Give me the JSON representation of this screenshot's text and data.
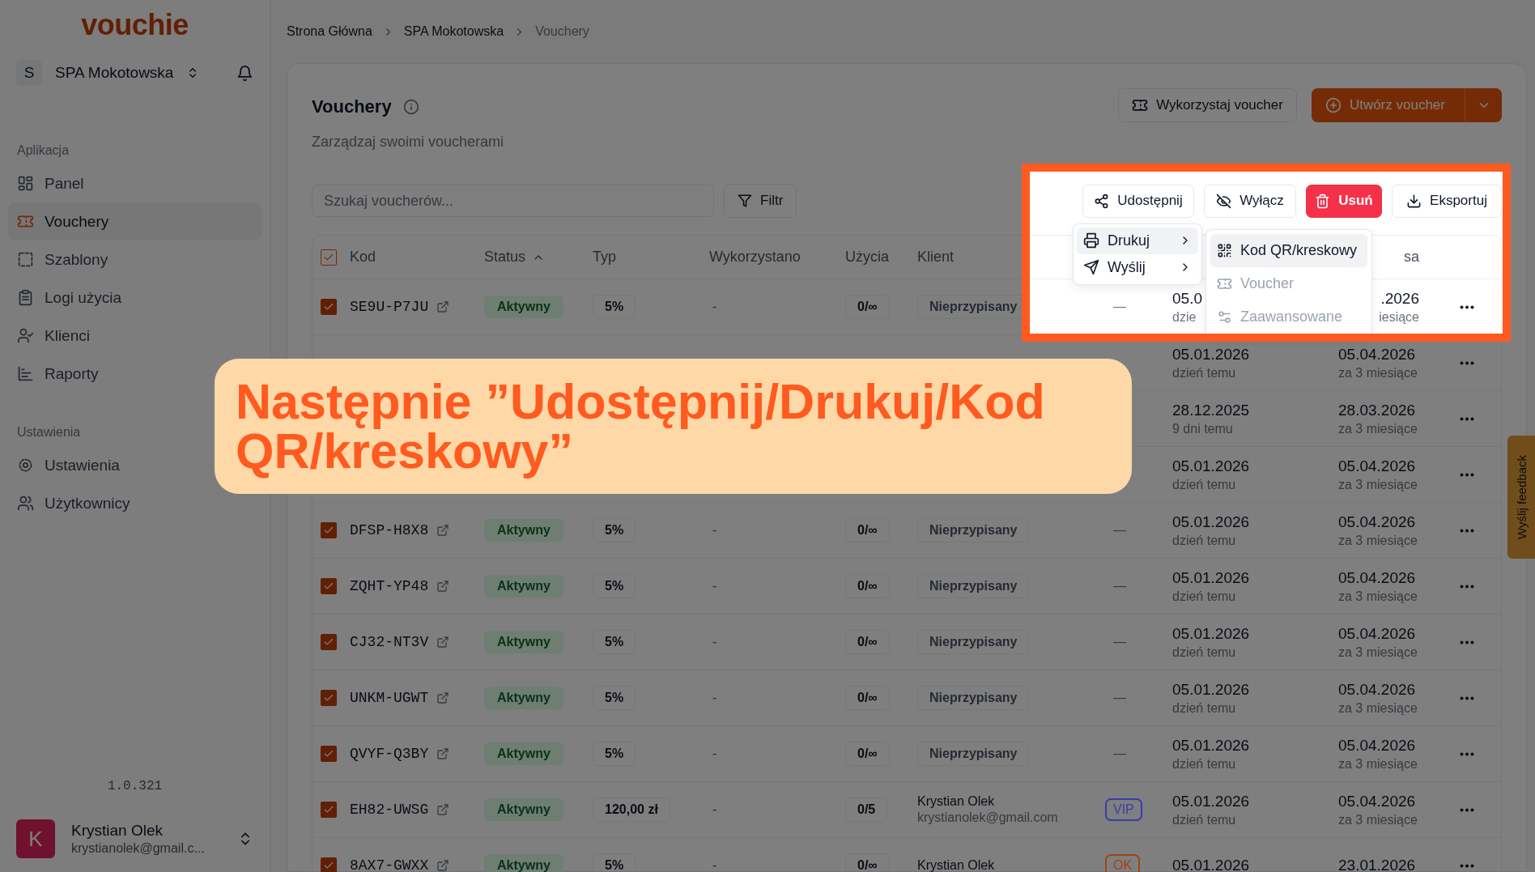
{
  "logo": "vouchie",
  "org": {
    "initial": "S",
    "name": "SPA Mokotowska"
  },
  "nav_sections": [
    {
      "title": "Aplikacja",
      "items": [
        {
          "label": "Panel",
          "selected": false
        },
        {
          "label": "Vouchery",
          "selected": true
        },
        {
          "label": "Szablony",
          "selected": false
        },
        {
          "label": "Logi użycia",
          "selected": false
        },
        {
          "label": "Klienci",
          "selected": false
        },
        {
          "label": "Raporty",
          "selected": false
        }
      ]
    },
    {
      "title": "Ustawienia",
      "items": [
        {
          "label": "Ustawienia",
          "selected": false
        },
        {
          "label": "Użytkownicy",
          "selected": false
        }
      ]
    }
  ],
  "version": "1.0.321",
  "user": {
    "initial": "K",
    "name": "Krystian Olek",
    "email": "krystianolek@gmail.c..."
  },
  "breadcrumb": [
    {
      "label": "Strona Główna",
      "current": false
    },
    {
      "label": "SPA Mokotowska",
      "current": false
    },
    {
      "label": "Vouchery",
      "current": true
    }
  ],
  "page": {
    "title": "Vouchery",
    "subtitle": "Zarządzaj swoimi voucherami",
    "buttons": [
      {
        "label": "Wykorzystaj voucher",
        "kind": "outline"
      },
      {
        "label": "Utwórz voucher",
        "kind": "primary"
      }
    ]
  },
  "search": {
    "placeholder": "Szukaj voucherów..."
  },
  "filter_button": "Filtr",
  "bulk_actions": [
    {
      "label": "Udostępnij",
      "kind": "outline"
    },
    {
      "label": "Wyłącz",
      "kind": "outline"
    },
    {
      "label": "Usuń",
      "kind": "danger"
    },
    {
      "label": "Eksportuj",
      "kind": "outline"
    }
  ],
  "share_menu": {
    "items": [
      {
        "label": "Drukuj",
        "highlighted": true
      },
      {
        "label": "Wyślij",
        "highlighted": false
      }
    ],
    "submenu": [
      {
        "label": "Kod QR/kreskowy",
        "highlighted": true,
        "disabled": false
      },
      {
        "label": "Voucher",
        "highlighted": false,
        "disabled": true
      },
      {
        "label": "Zaawansowane",
        "highlighted": false,
        "disabled": true
      }
    ]
  },
  "table": {
    "select_all": {
      "checked": true
    },
    "columns": [
      {
        "label": "Kod",
        "sorted": false
      },
      {
        "label": "Status",
        "sorted": true
      },
      {
        "label": "Typ",
        "sorted": false
      },
      {
        "label": "Wykorzystano",
        "sorted": false
      },
      {
        "label": "Użycia",
        "sorted": false
      },
      {
        "label": "Klient",
        "sorted": false
      },
      {
        "label": "sa",
        "sorted": false
      }
    ],
    "rows": [
      {
        "kind": "partial",
        "checked": true,
        "code": "SE9U-P7JU",
        "status": "Aktywny",
        "type": "5%",
        "used": "-",
        "usage": "0/∞",
        "client": {
          "kind": "unassigned",
          "label": "Nieprzypisany"
        },
        "tag": {
          "kind": "none",
          "text": "—"
        },
        "created": "05.0",
        "created_rel": "dzie",
        "expires": ".2026",
        "expires_rel": "iesiące"
      },
      {
        "kind": "covered",
        "created": "05.01.2026",
        "created_rel": "dzień temu",
        "expires": "05.04.2026",
        "expires_rel": "za 3 miesiące"
      },
      {
        "kind": "covered",
        "created": "28.12.2025",
        "created_rel": "9 dni temu",
        "expires": "28.03.2026",
        "expires_rel": "za 3 miesiące"
      },
      {
        "kind": "covered",
        "created": "05.01.2026",
        "created_rel": "dzień temu",
        "expires": "05.04.2026",
        "expires_rel": "za 3 miesiące"
      },
      {
        "kind": "full",
        "checked": true,
        "code": "DFSP-H8X8",
        "status": "Aktywny",
        "type": "5%",
        "used": "-",
        "usage": "0/∞",
        "client": {
          "kind": "unassigned",
          "label": "Nieprzypisany"
        },
        "tag": {
          "kind": "none",
          "text": "—"
        },
        "created": "05.01.2026",
        "created_rel": "dzień temu",
        "expires": "05.04.2026",
        "expires_rel": "za 3 miesiące"
      },
      {
        "kind": "full",
        "checked": true,
        "code": "ZQHT-YP48",
        "status": "Aktywny",
        "type": "5%",
        "used": "-",
        "usage": "0/∞",
        "client": {
          "kind": "unassigned",
          "label": "Nieprzypisany"
        },
        "tag": {
          "kind": "none",
          "text": "—"
        },
        "created": "05.01.2026",
        "created_rel": "dzień temu",
        "expires": "05.04.2026",
        "expires_rel": "za 3 miesiące"
      },
      {
        "kind": "full",
        "checked": true,
        "code": "CJ32-NT3V",
        "status": "Aktywny",
        "type": "5%",
        "used": "-",
        "usage": "0/∞",
        "client": {
          "kind": "unassigned",
          "label": "Nieprzypisany"
        },
        "tag": {
          "kind": "none",
          "text": "—"
        },
        "created": "05.01.2026",
        "created_rel": "dzień temu",
        "expires": "05.04.2026",
        "expires_rel": "za 3 miesiące"
      },
      {
        "kind": "full",
        "checked": true,
        "code": "UNKM-UGWT",
        "status": "Aktywny",
        "type": "5%",
        "used": "-",
        "usage": "0/∞",
        "client": {
          "kind": "unassigned",
          "label": "Nieprzypisany"
        },
        "tag": {
          "kind": "none",
          "text": "—"
        },
        "created": "05.01.2026",
        "created_rel": "dzień temu",
        "expires": "05.04.2026",
        "expires_rel": "za 3 miesiące"
      },
      {
        "kind": "full",
        "checked": true,
        "code": "QVYF-Q3BY",
        "status": "Aktywny",
        "type": "5%",
        "used": "-",
        "usage": "0/∞",
        "client": {
          "kind": "unassigned",
          "label": "Nieprzypisany"
        },
        "tag": {
          "kind": "none",
          "text": "—"
        },
        "created": "05.01.2026",
        "created_rel": "dzień temu",
        "expires": "05.04.2026",
        "expires_rel": "za 3 miesiące"
      },
      {
        "kind": "full",
        "checked": true,
        "code": "EH82-UWSG",
        "status": "Aktywny",
        "type": "120,00 zł",
        "used": "-",
        "usage": "0/5",
        "client": {
          "kind": "person",
          "name": "Krystian Olek",
          "email": "krystianolek@gmail.com"
        },
        "tag": {
          "kind": "label",
          "text": "VIP",
          "color": "#3c3aa8"
        },
        "created": "05.01.2026",
        "created_rel": "dzień temu",
        "expires": "05.04.2026",
        "expires_rel": "za 3 miesiące"
      },
      {
        "kind": "full",
        "checked": true,
        "code": "8AX7-GWXX",
        "status": "Aktywny",
        "type": "5%",
        "used": "-",
        "usage": "0/∞",
        "client": {
          "kind": "person",
          "name": "Krystian Olek"
        },
        "tag": {
          "kind": "label",
          "text": "OK",
          "color": "#a4420e"
        },
        "created": "05.01.2026",
        "expires": "23.01.2026"
      }
    ]
  },
  "caption": "Następnie ”Udostępnij/Drukuj/Kod QR/kreskowy”",
  "feedback_tab": "Wyślij feedback"
}
